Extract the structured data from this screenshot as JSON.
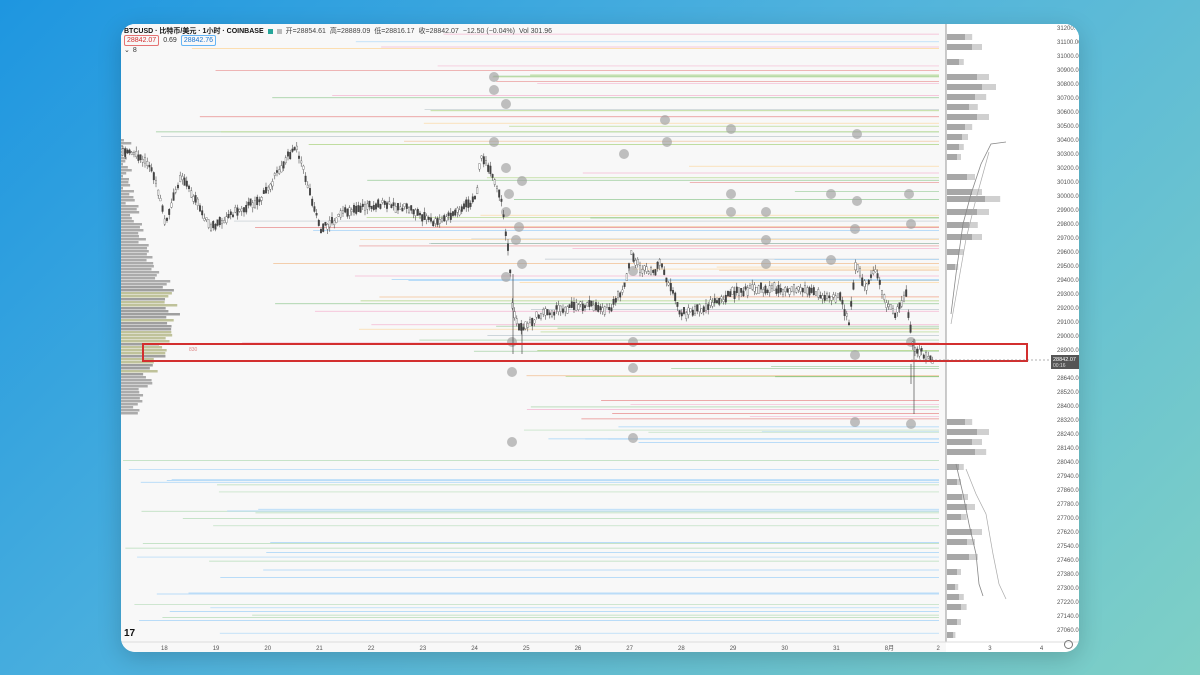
{
  "header": {
    "symbol": "BTCUSD · 比特币/美元 · 1小时 · COINBASE",
    "open": "开=28854.61",
    "high": "高=28889.09",
    "low": "低=28816.17",
    "close": "收=28842.07",
    "change": "−12.50 (−0.04%)",
    "volume": "Vol 301.96",
    "bid": "28842.07",
    "spread": "0.69",
    "ask": "28842.76",
    "indicator_count": "8"
  },
  "price_axis": {
    "labels": [
      "31200.00",
      "31100.00",
      "31000.00",
      "30900.00",
      "30800.00",
      "30700.00",
      "30600.00",
      "30500.00",
      "30400.00",
      "30300.00",
      "30200.00",
      "30100.00",
      "30000.00",
      "29900.00",
      "29800.00",
      "29700.00",
      "29600.00",
      "29500.00",
      "29400.00",
      "29300.00",
      "29200.00",
      "29100.00",
      "29000.00",
      "28900.00",
      "28760.00",
      "28640.00",
      "28520.00",
      "28400.00",
      "28320.00",
      "28240.00",
      "28140.00",
      "28040.00",
      "27940.00",
      "27860.00",
      "27780.00",
      "27700.00",
      "27620.00",
      "27540.00",
      "27460.00",
      "27380.00",
      "27300.00",
      "27220.00",
      "27140.00",
      "27060.00"
    ],
    "current_price": "28842.07",
    "current_sub": "00:16"
  },
  "time_axis": {
    "labels": [
      "18",
      "19",
      "20",
      "21",
      "22",
      "23",
      "24",
      "25",
      "26",
      "27",
      "28",
      "29",
      "30",
      "31",
      "8月",
      "2",
      "3",
      "4"
    ]
  },
  "chart": {
    "profile_label": "830",
    "logo": "17"
  },
  "colors": {
    "up": "#26a69a",
    "down": "#555555",
    "highlight": "#d32f2f"
  }
}
